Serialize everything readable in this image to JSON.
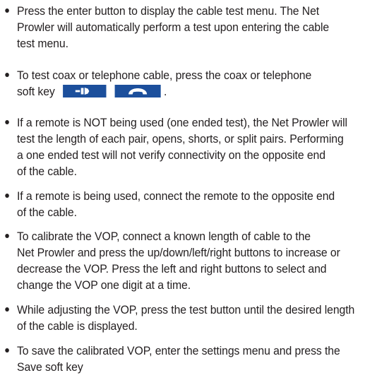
{
  "bullets": [
    {
      "lines": [
        "Press the enter button to display the cable test menu. The Net",
        "Prowler will automatically perform a test upon entering the cable",
        "test menu."
      ]
    },
    {
      "lines": [
        "To test coax or telephone cable, press the coax or telephone",
        "soft key"
      ],
      "end_text": ".",
      "icons": [
        "coax-softkey-icon",
        "telephone-softkey-icon"
      ]
    },
    {
      "lines": [
        "If a remote is NOT being used (one ended test), the Net Prowler will",
        "test the length of each pair, opens, shorts, or split pairs. Performing",
        "a one ended test will not verify connectivity on the opposite end",
        "of the cable."
      ]
    },
    {
      "lines": [
        "If a remote is being used, connect the remote to the opposite end",
        "of the cable."
      ]
    },
    {
      "lines": [
        "To calibrate the VOP, connect a known length of cable to the",
        "Net Prowler and press the up/down/left/right buttons to increase or",
        "decrease the VOP. Press the left and right buttons to select and",
        "change the VOP one digit at a time."
      ]
    },
    {
      "lines": [
        "While adjusting the VOP, press the test button until the desired length",
        "of the cable is displayed."
      ]
    },
    {
      "lines": [
        "To save the calibrated VOP, enter the settings menu and press the",
        "Save soft key"
      ]
    }
  ],
  "colors": {
    "text": "#231f20",
    "softkey_background": "#1c4f9c",
    "softkey_glyph": "#ffffff"
  }
}
